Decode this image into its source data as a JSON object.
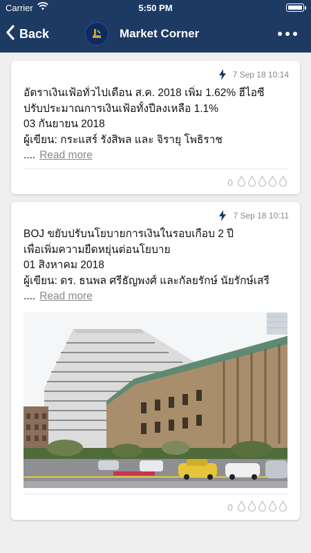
{
  "status_bar": {
    "carrier": "Carrier",
    "time": "5:50 PM"
  },
  "nav": {
    "back_label": "Back",
    "title": "Market Corner"
  },
  "articles": [
    {
      "timestamp": "7 Sep 18 10:14",
      "lines": [
        "อัตราเงินเฟ้อทั่วไปเดือน ส.ค. 2018 เพิ่ม 1.62% ฮีไอซี",
        "ปรับประมาณการเงินเฟ้อทั้งปีลงเหลือ 1.1%",
        "03 กันยายน 2018",
        "ผู้เขียน: กระแสร์ รังสิพล และ จิรายุ โพธิราช"
      ],
      "ellipsis": "....",
      "read_more": "Read more",
      "like_count": "0"
    },
    {
      "timestamp": "7 Sep 18 10:11",
      "lines": [
        "BOJ ขยับปรับนโยบายการเงินในรอบเกือบ 2 ปี",
        "เพื่อเพิ่มความยืดหยุ่นต่อนโยบาย",
        "01 สิงหาคม 2018",
        "ผู้เขียน: ดร. ธนพล ศรีธัญพงศ์ และกัลยรักษ์ นัยรักษ์เสรี"
      ],
      "ellipsis": "....",
      "read_more": "Read more",
      "like_count": "0"
    }
  ],
  "colors": {
    "navbar": "#1d3a63",
    "background": "#efefef",
    "muted": "#888888"
  },
  "icons": {
    "back": "chevron-left-icon",
    "logo": "scb-logo-icon",
    "more": "more-dots-icon",
    "bolt": "lightning-icon",
    "drop": "water-drop-icon"
  }
}
